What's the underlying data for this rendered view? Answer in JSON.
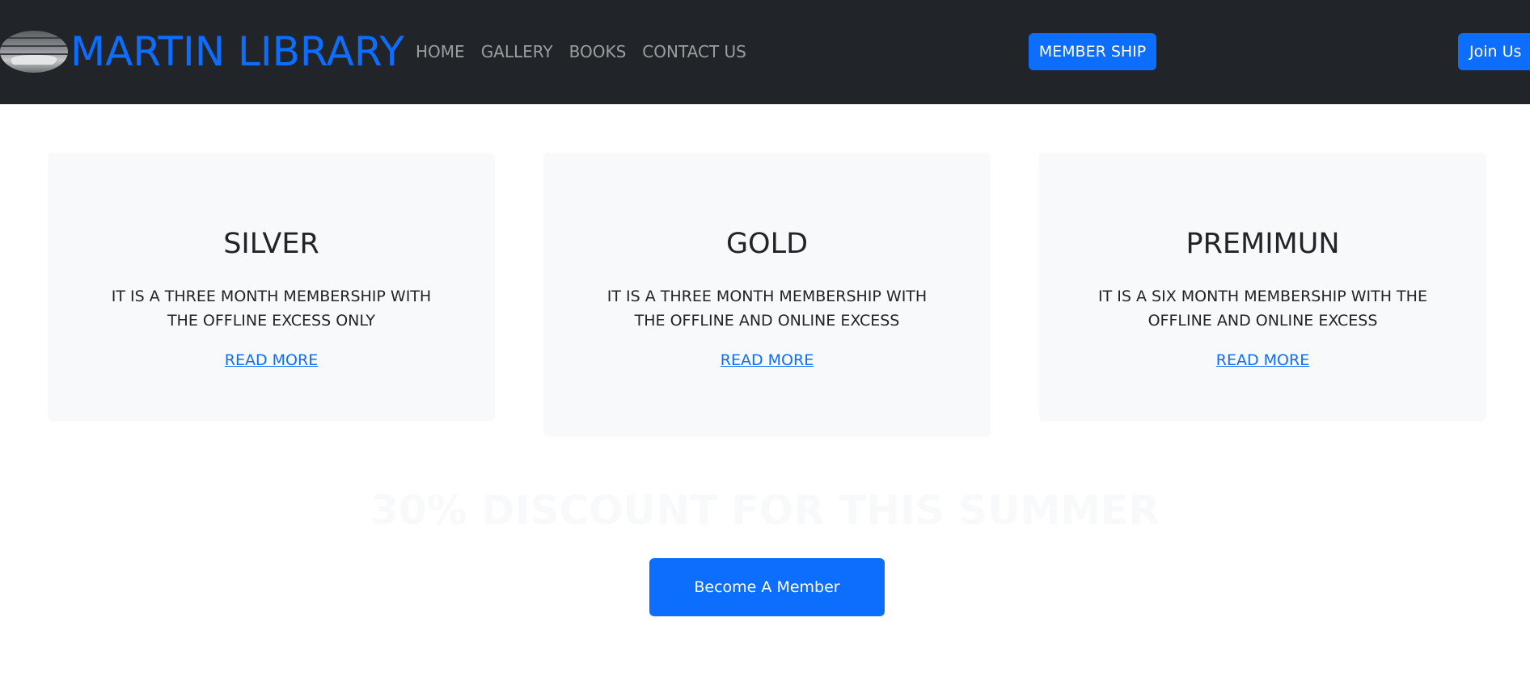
{
  "navbar": {
    "brand": "MARTIN LIBRARY",
    "logo_icon": "library-books-image",
    "links": [
      "HOME",
      "GALLERY",
      "BOOKS",
      "CONTACT US"
    ],
    "membership_label": "MEMBER SHIP",
    "join_label": "Join Us"
  },
  "cards": [
    {
      "title": "SILVER",
      "description": "IT IS A THREE MONTH MEMBERSHIP WITH THE OFFLINE EXCESS ONLY",
      "link": "READ MORE"
    },
    {
      "title": "GOLD",
      "description": "IT IS A THREE MONTH MEMBERSHIP WITH THE OFFLINE AND ONLINE EXCESS",
      "link": "READ MORE"
    },
    {
      "title": "PREMIMUN",
      "description": "IT IS A SIX MONTH MEMBERSHIP WITH THE OFFLINE AND ONLINE EXCESS",
      "link": "READ MORE"
    }
  ],
  "promo": {
    "headline": "30% DISCOUNT FOR THIS SUMMER",
    "cta_label": "Become A Member"
  },
  "colors": {
    "navbar_bg": "#212529",
    "primary": "#0d6efd",
    "card_bg": "#f8f9fa",
    "text": "#212529"
  }
}
